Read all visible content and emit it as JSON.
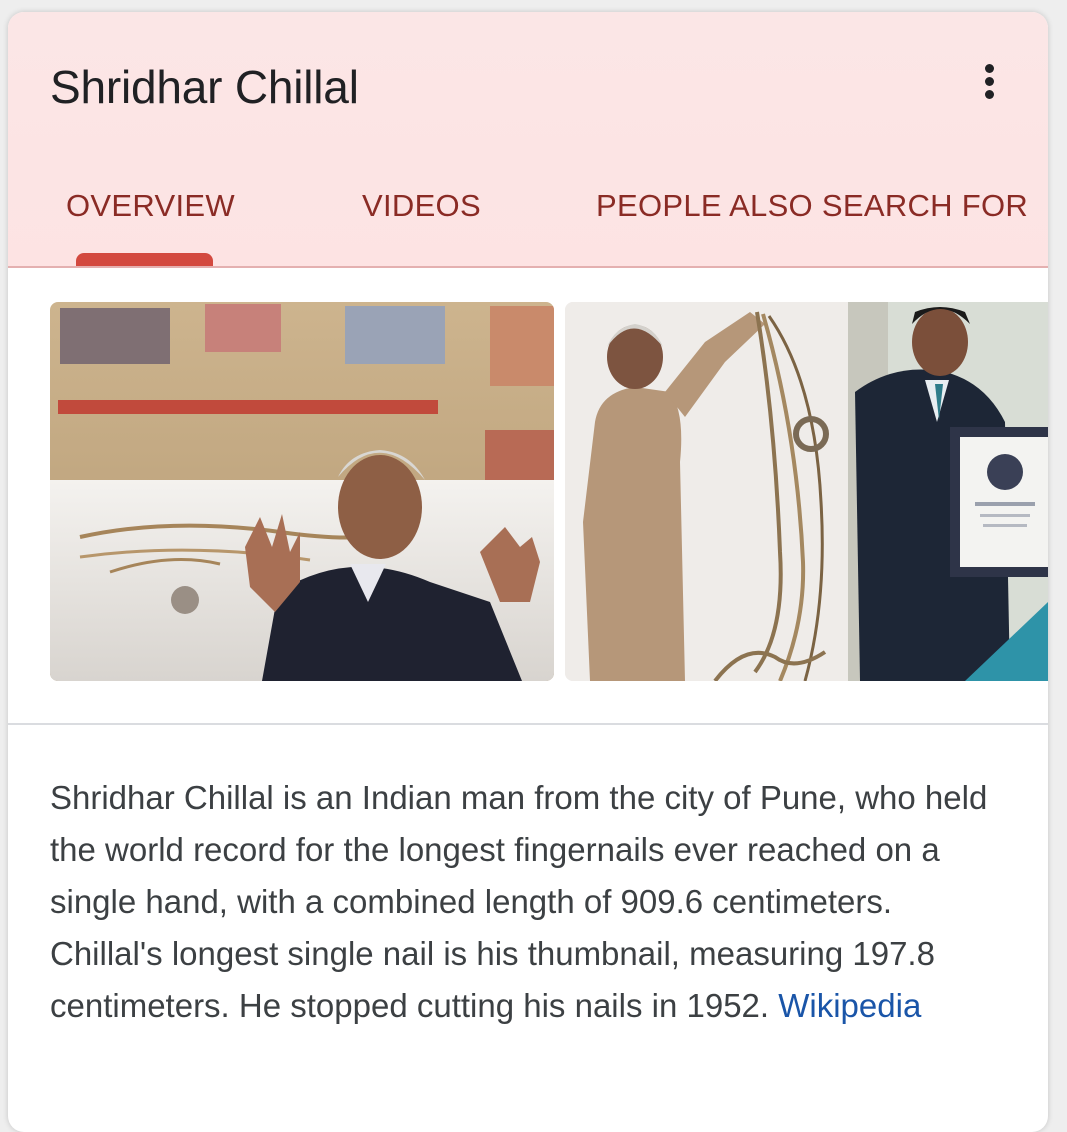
{
  "header": {
    "title": "Shridhar Chillal",
    "menu_icon": "more-vert-icon"
  },
  "tabs": [
    {
      "label": "OVERVIEW",
      "selected": true
    },
    {
      "label": "VIDEOS",
      "selected": false
    },
    {
      "label": "PEOPLE ALSO SEARCH FOR",
      "selected": false
    }
  ],
  "colors": {
    "header_bg": "#fde3e3",
    "tab_text": "#8a2b25",
    "tab_indicator": "#d3493f",
    "link": "#1a55a8"
  },
  "description": {
    "text": "Shridhar Chillal is an Indian man from the city of Pune, who held the world record for the longest fingernails ever reached on a single hand, with a combined length of 909.6 centimeters. Chillal's longest single nail is his thumbnail, measuring 197.8 centimeters. He stopped cutting his nails in 1952. ",
    "source_link": "Wikipedia"
  }
}
